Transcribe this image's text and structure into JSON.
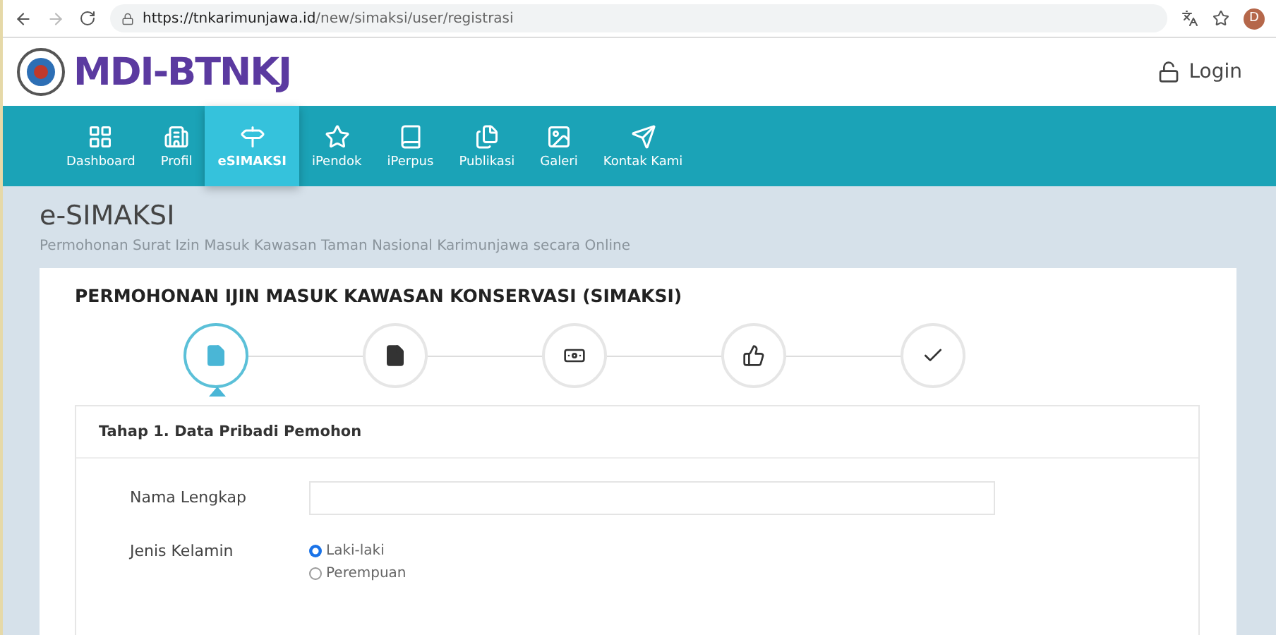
{
  "browser": {
    "url_host": "https://tnkarimunjawa.id",
    "url_path": "/new/simaksi/user/registrasi",
    "profile_initial": "D"
  },
  "header": {
    "logo": "MDI-BTNKJ",
    "login": "Login"
  },
  "nav": [
    {
      "label": "Dashboard",
      "kind": "grid",
      "selected": false
    },
    {
      "label": "Profil",
      "kind": "building",
      "selected": false
    },
    {
      "label": "eSIMAKSI",
      "kind": "signpost",
      "selected": true
    },
    {
      "label": "iPendok",
      "kind": "star",
      "selected": false
    },
    {
      "label": "iPerpus",
      "kind": "book",
      "selected": false
    },
    {
      "label": "Publikasi",
      "kind": "files",
      "selected": false
    },
    {
      "label": "Galeri",
      "kind": "image",
      "selected": false
    },
    {
      "label": "Kontak Kami",
      "kind": "send",
      "selected": false
    }
  ],
  "page": {
    "title": "e-SIMAKSI",
    "subtitle": "Permohonan Surat Izin Masuk Kawasan Taman Nasional Karimunjawa secara Online"
  },
  "card": {
    "title": "PERMOHONAN IJIN MASUK KAWASAN KONSERVASI (SIMAKSI)",
    "steps": [
      {
        "kind": "file",
        "selected": true
      },
      {
        "kind": "file",
        "selected": false
      },
      {
        "kind": "money",
        "selected": false
      },
      {
        "kind": "thumbs",
        "selected": false
      },
      {
        "kind": "check",
        "selected": false
      }
    ],
    "section": {
      "title": "Tahap 1. Data Pribadi Pemohon",
      "fields": [
        {
          "label": "Nama Lengkap",
          "kind": "text"
        },
        {
          "label": "Jenis Kelamin",
          "kind": "radio",
          "options": [
            {
              "label": "Laki-laki",
              "selected": true
            },
            {
              "label": "Perempuan",
              "selected": false
            }
          ]
        }
      ]
    }
  }
}
